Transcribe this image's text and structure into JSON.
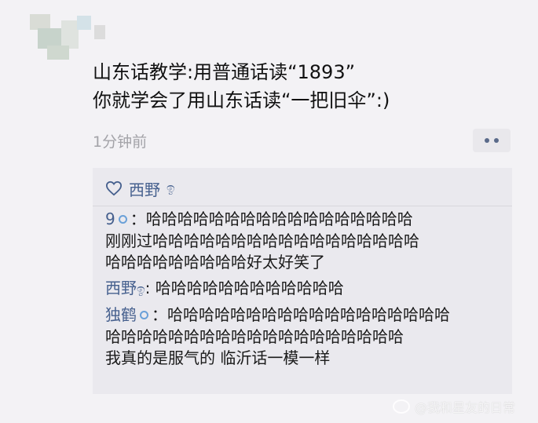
{
  "post": {
    "line1": "山东话教学:用普通话读“1893”",
    "line2": "你就学会了用山东话读“一把旧伞”:)",
    "time": "1分钟前"
  },
  "likes": {
    "names": "西野",
    "emoji": "ඉ"
  },
  "comments": [
    {
      "author": "9",
      "lines": [
        "：哈哈哈哈哈哈哈哈哈哈哈哈哈哈哈哈哈",
        "刚刚过哈哈哈哈哈哈哈哈哈哈哈哈哈哈哈哈哈",
        "哈哈哈哈哈哈哈哈哈好太好笑了"
      ]
    },
    {
      "author": "西野",
      "emoji": "ඉ",
      "lines": [
        ": 哈哈哈哈哈哈哈哈哈哈哈哈"
      ]
    },
    {
      "author": "独鹤",
      "lines": [
        "：哈哈哈哈哈哈哈哈哈哈哈哈哈哈哈哈哈哈",
        "哈哈哈哈哈哈哈哈哈哈哈哈哈哈哈哈哈哈哈",
        "我真的是服气的 临沂话一模一样"
      ]
    }
  ],
  "watermark": "@我和星友的日常",
  "icons": {
    "like": "heart-outline-icon",
    "more": "more-dots-icon",
    "weibo": "weibo-logo-icon",
    "verified": "ring-badge-icon"
  },
  "colors": {
    "link": "#46608e",
    "background": "#f3f2f5",
    "comment_bg": "#eae9ee"
  }
}
